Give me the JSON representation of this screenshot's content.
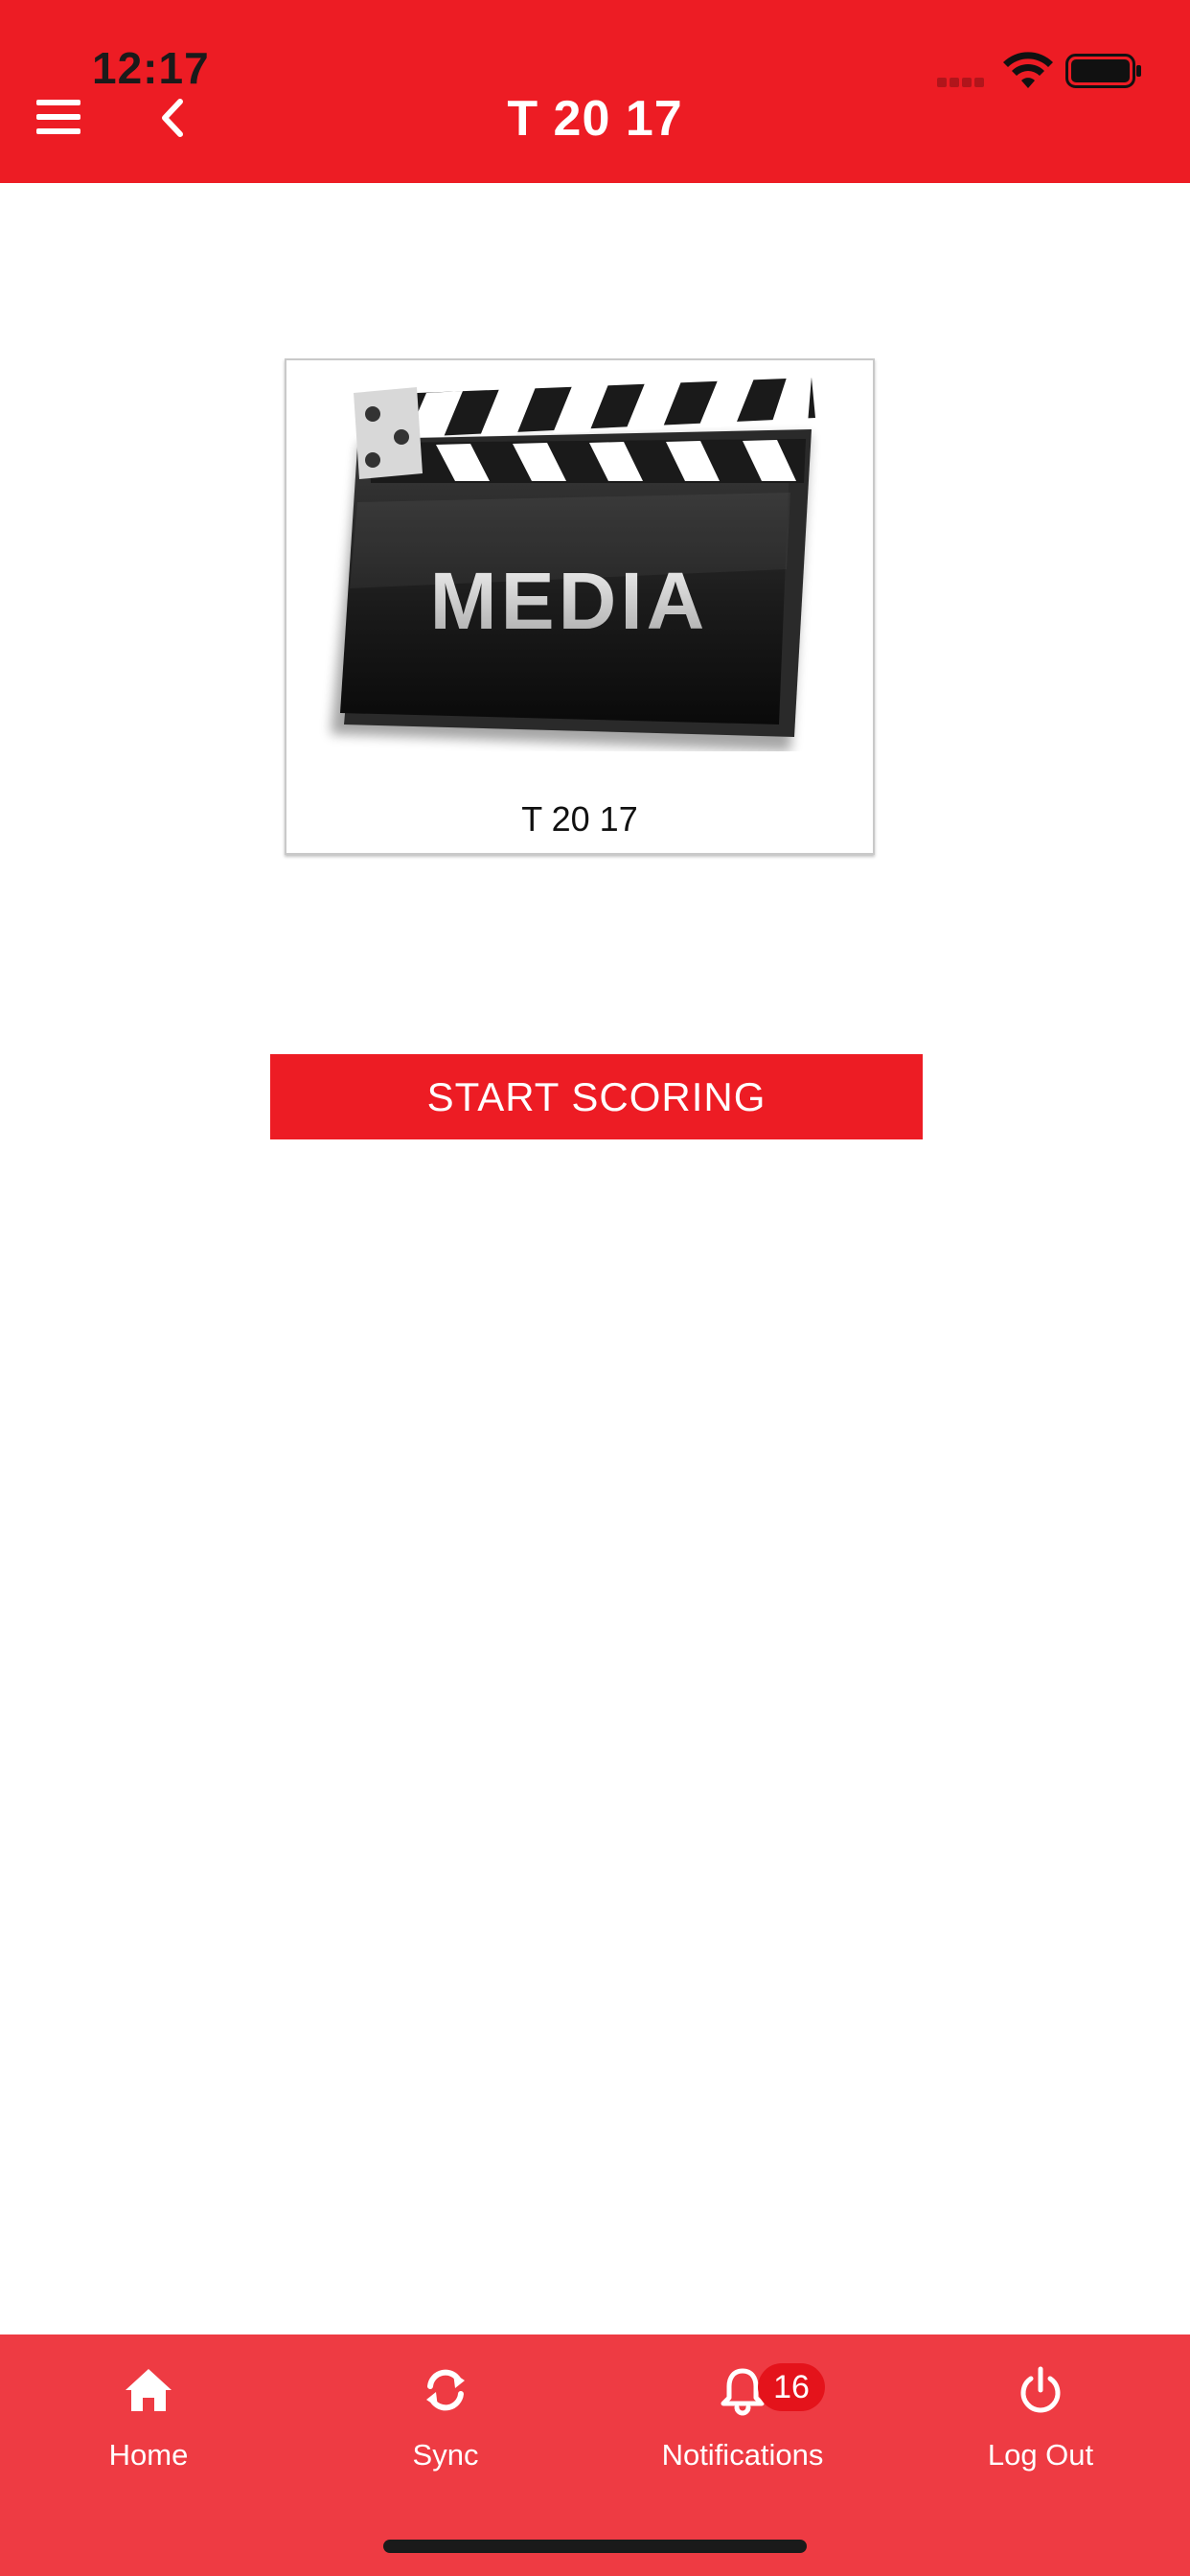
{
  "status_bar": {
    "time": "12:17"
  },
  "header": {
    "title": "T 20 17",
    "background_color": "#ED1C24"
  },
  "media_card": {
    "image_text": "MEDIA",
    "caption": "T 20 17"
  },
  "start_button": {
    "label": "START SCORING",
    "color": "#ED1C24"
  },
  "bottom_nav": {
    "background_color": "#EE3B43",
    "items": [
      {
        "label": "Home",
        "icon": "home-icon"
      },
      {
        "label": "Sync",
        "icon": "sync-icon"
      },
      {
        "label": "Notifications",
        "icon": "bell-icon",
        "badge": "16"
      },
      {
        "label": "Log Out",
        "icon": "power-icon"
      }
    ]
  }
}
